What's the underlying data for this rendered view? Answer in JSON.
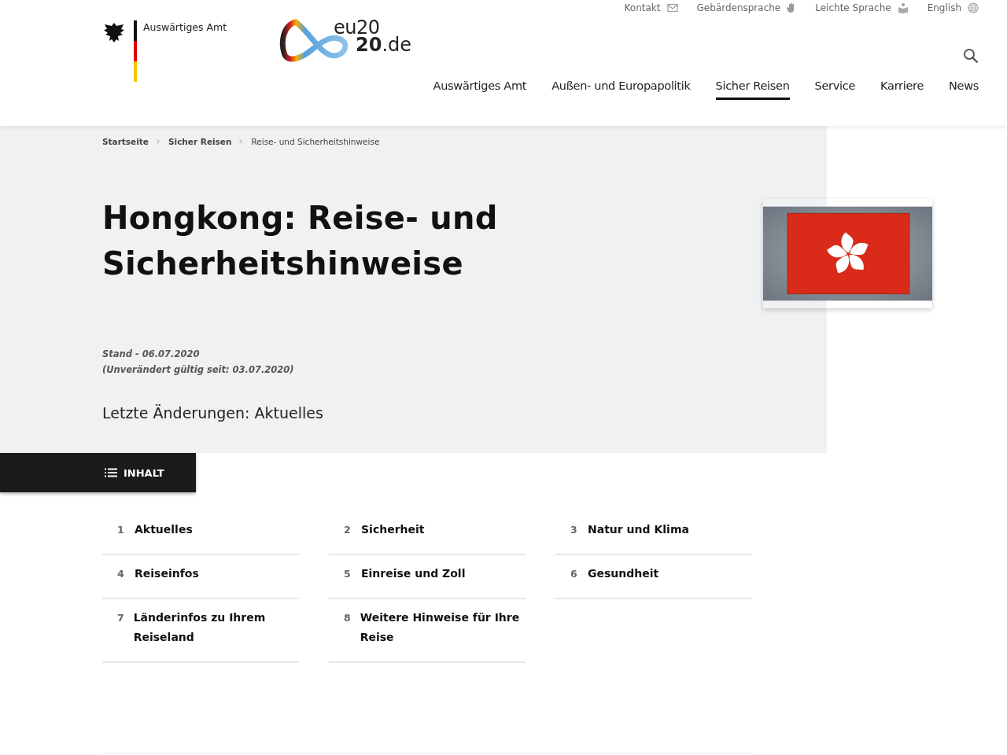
{
  "header": {
    "ministry_name": "Auswärtiges Amt",
    "eu_logo": {
      "line_1": "eu20",
      "line_2": "20",
      "line_2_suffix": ".de"
    },
    "service_links": [
      {
        "label": "Kontakt",
        "kind": "mail"
      },
      {
        "label": "Gebärdensprache",
        "kind": "hand"
      },
      {
        "label": "Leichte Sprache",
        "kind": "book"
      },
      {
        "label": "English",
        "kind": "globe"
      }
    ],
    "nav": [
      {
        "label": "Auswärtiges Amt",
        "selected": false
      },
      {
        "label": "Außen- und Europapolitik",
        "selected": false
      },
      {
        "label": "Sicher Reisen",
        "selected": true
      },
      {
        "label": "Service",
        "selected": false
      },
      {
        "label": "Karriere",
        "selected": false
      },
      {
        "label": "News",
        "selected": false
      }
    ]
  },
  "breadcrumb": [
    "Startseite",
    "Sicher Reisen",
    "Reise- und Sicherheitshinweise"
  ],
  "title": "Hongkong: Reise- und Sicherheitshinweise",
  "status": [
    "Stand - 06.07.2020",
    "(Unverändert gültig seit: 03.07.2020)"
  ],
  "last_changes": "Letzte Änderungen: Aktuelles",
  "contents_button": "INHALT",
  "contents": [
    {
      "number": "1",
      "label": "Aktuelles"
    },
    {
      "number": "2",
      "label": "Sicherheit"
    },
    {
      "number": "3",
      "label": "Natur und Klima"
    },
    {
      "number": "4",
      "label": "Reiseinfos"
    },
    {
      "number": "5",
      "label": "Einreise und Zoll"
    },
    {
      "number": "6",
      "label": "Gesundheit"
    },
    {
      "number": "7",
      "label": "Länderinfos zu Ihrem Reiseland"
    },
    {
      "number": "8",
      "label": "Weitere Hinweise für Ihre Reise"
    }
  ]
}
